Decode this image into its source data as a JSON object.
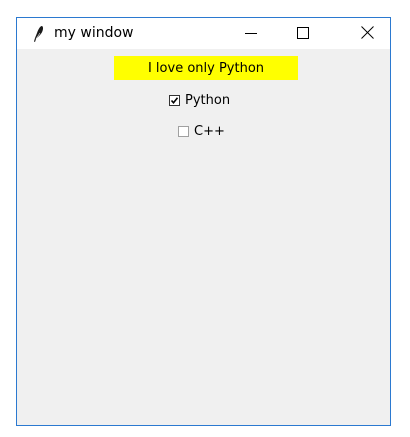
{
  "window": {
    "title": "my window"
  },
  "content": {
    "label_text": "I love only Python",
    "label_background": "#ffff00",
    "checkboxes": [
      {
        "label": "Python",
        "checked": true
      },
      {
        "label": "C++",
        "checked": false
      }
    ]
  },
  "icons": {
    "app": "feather-icon",
    "minimize": "minimize-icon",
    "maximize": "maximize-icon",
    "close": "close-icon"
  },
  "colors": {
    "window_border": "#2b79d0",
    "background": "#f0f0f0",
    "titlebar": "#ffffff"
  }
}
